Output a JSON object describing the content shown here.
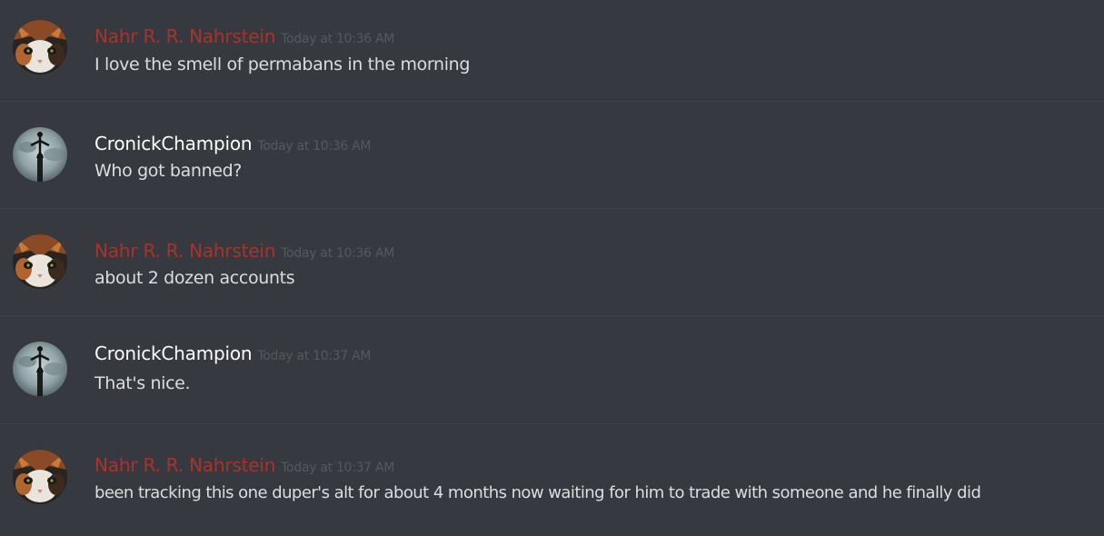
{
  "colors": {
    "background": "#36393f",
    "divider": "#40434a",
    "message_text": "#dcddde",
    "timestamp": "#56585c"
  },
  "users": {
    "nahr": {
      "name": "Nahr R. R. Nahrstein",
      "color": "#a8332b",
      "avatar": "cat-avatar"
    },
    "cronick": {
      "name": "CronickChampion",
      "color": "#ffffff",
      "avatar": "figure-avatar"
    }
  },
  "messages": [
    {
      "author": "Nahr R. R. Nahrstein",
      "timestamp": "Today at 10:36 AM",
      "text": "I love the smell of permabans in the morning"
    },
    {
      "author": "CronickChampion",
      "timestamp": "Today at 10:36 AM",
      "text": "Who got banned?"
    },
    {
      "author": "Nahr R. R. Nahrstein",
      "timestamp": "Today at 10:36 AM",
      "text": "about 2 dozen accounts"
    },
    {
      "author": "CronickChampion",
      "timestamp": "Today at 10:37 AM",
      "text": "That's nice."
    },
    {
      "author": "Nahr R. R. Nahrstein",
      "timestamp": "Today at 10:37 AM",
      "text": "been tracking this one duper's alt for about 4 months now waiting for him to trade with someone and he finally did"
    }
  ]
}
